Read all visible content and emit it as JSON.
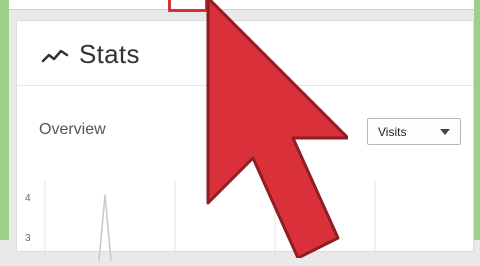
{
  "header": {
    "title": "Stats"
  },
  "overview": {
    "label": "Overview",
    "metric_select": {
      "selected": "Visits"
    }
  },
  "chart_data": {
    "type": "line",
    "y_ticks": [
      "4",
      "3"
    ],
    "series": [
      {
        "values": [
          0,
          4,
          0
        ]
      }
    ]
  },
  "colors": {
    "frame": "#9fd08a",
    "cursor": "#d9303a",
    "highlight": "#d9303a"
  },
  "icons": {
    "stats": "trend-line-icon",
    "select": "chevron-down-icon",
    "pointer": "red-pointer-cursor-icon"
  }
}
